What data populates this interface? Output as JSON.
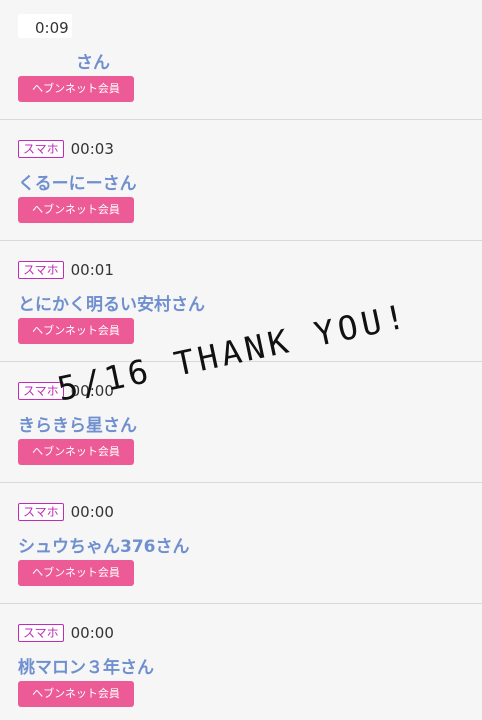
{
  "entries": [
    {
      "badge": "",
      "time": "0:09",
      "name": "さん",
      "member_label": "ヘブンネット会員"
    },
    {
      "badge": "スマホ",
      "time": "00:03",
      "name": "くるーにーさん",
      "member_label": "ヘブンネット会員"
    },
    {
      "badge": "スマホ",
      "time": "00:01",
      "name": "とにかく明るい安村さん",
      "member_label": "ヘブンネット会員"
    },
    {
      "badge": "スマホ",
      "time": "00:00",
      "name": "きらきら星さん",
      "member_label": "ヘブンネット会員"
    },
    {
      "badge": "スマホ",
      "time": "00:00",
      "name": "シュウちゃん376さん",
      "member_label": "ヘブンネット会員"
    },
    {
      "badge": "スマホ",
      "time": "00:00",
      "name": "桃マロン３年さん",
      "member_label": "ヘブンネット会員"
    }
  ],
  "overlay": {
    "text": "5/16 THANK YOU!"
  }
}
